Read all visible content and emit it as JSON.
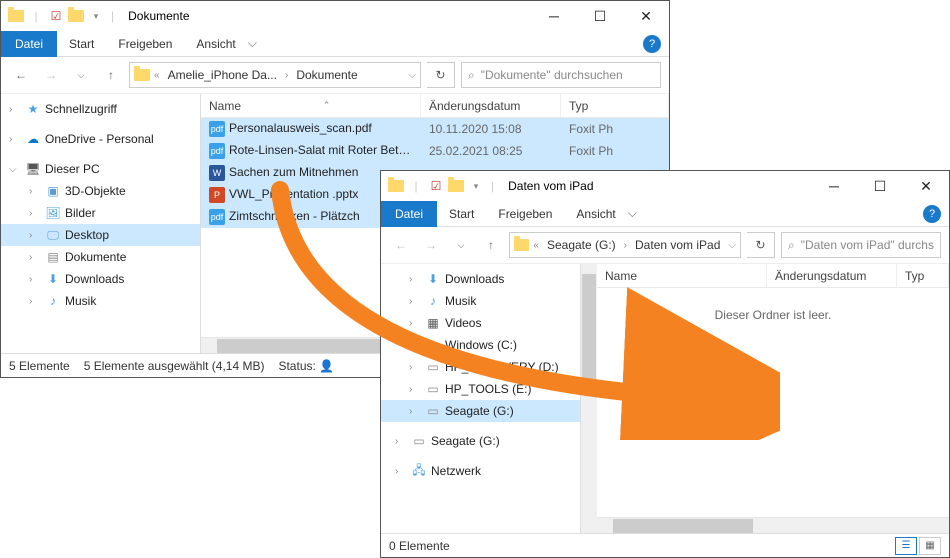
{
  "win1": {
    "title": "Dokumente",
    "ribbon": {
      "file": "Datei",
      "tabs": [
        "Start",
        "Freigeben",
        "Ansicht"
      ]
    },
    "breadcrumb": [
      "Amelie_iPhone Da...",
      "Dokumente"
    ],
    "search_placeholder": "\"Dokumente\" durchsuchen",
    "columns": {
      "name": "Name",
      "date": "Änderungsdatum",
      "type": "Typ"
    },
    "sidebar": [
      {
        "label": "Schnellzugriff"
      },
      {
        "label": "OneDrive - Personal"
      },
      {
        "label": "Dieser PC"
      },
      {
        "label": "3D-Objekte"
      },
      {
        "label": "Bilder"
      },
      {
        "label": "Desktop"
      },
      {
        "label": "Dokumente"
      },
      {
        "label": "Downloads"
      },
      {
        "label": "Musik"
      }
    ],
    "files": [
      {
        "name": "Personalausweis_scan.pdf",
        "date": "10.11.2020 15:08",
        "type": "Foxit Ph",
        "color": "#3aa0e8",
        "ext": "pdf"
      },
      {
        "name": "Rote-Linsen-Salat mit Roter Bete von Ses...",
        "date": "25.02.2021 08:25",
        "type": "Foxit Ph",
        "color": "#3aa0e8",
        "ext": "pdf"
      },
      {
        "name": "Sachen zum Mitnehmen",
        "date": "",
        "type": "",
        "color": "#2b579a",
        "ext": "W"
      },
      {
        "name": "VWL_Präsentation .pptx",
        "date": "",
        "type": "",
        "color": "#d24726",
        "ext": "P"
      },
      {
        "name": "Zimtschnecken - Plätzch",
        "date": "",
        "type": "",
        "color": "#3aa0e8",
        "ext": "pdf"
      }
    ],
    "status": {
      "count": "5 Elemente",
      "selected": "5 Elemente ausgewählt (4,14 MB)",
      "status_label": "Status:"
    }
  },
  "win2": {
    "title": "Daten vom iPad",
    "ribbon": {
      "file": "Datei",
      "tabs": [
        "Start",
        "Freigeben",
        "Ansicht"
      ]
    },
    "breadcrumb": [
      "Seagate (G:)",
      "Daten vom iPad"
    ],
    "search_placeholder": "\"Daten vom iPad\" durchs",
    "columns": {
      "name": "Name",
      "date": "Änderungsdatum",
      "type": "Typ"
    },
    "empty": "Dieser Ordner ist leer.",
    "sidebar": [
      {
        "label": "Downloads"
      },
      {
        "label": "Musik"
      },
      {
        "label": "Videos"
      },
      {
        "label": "Windows (C:)"
      },
      {
        "label": "HP_RECOVERY (D:)"
      },
      {
        "label": "HP_TOOLS (E:)"
      },
      {
        "label": "Seagate (G:)"
      },
      {
        "label": "Seagate (G:)"
      },
      {
        "label": "Netzwerk"
      }
    ],
    "status": {
      "count": "0 Elemente"
    }
  }
}
